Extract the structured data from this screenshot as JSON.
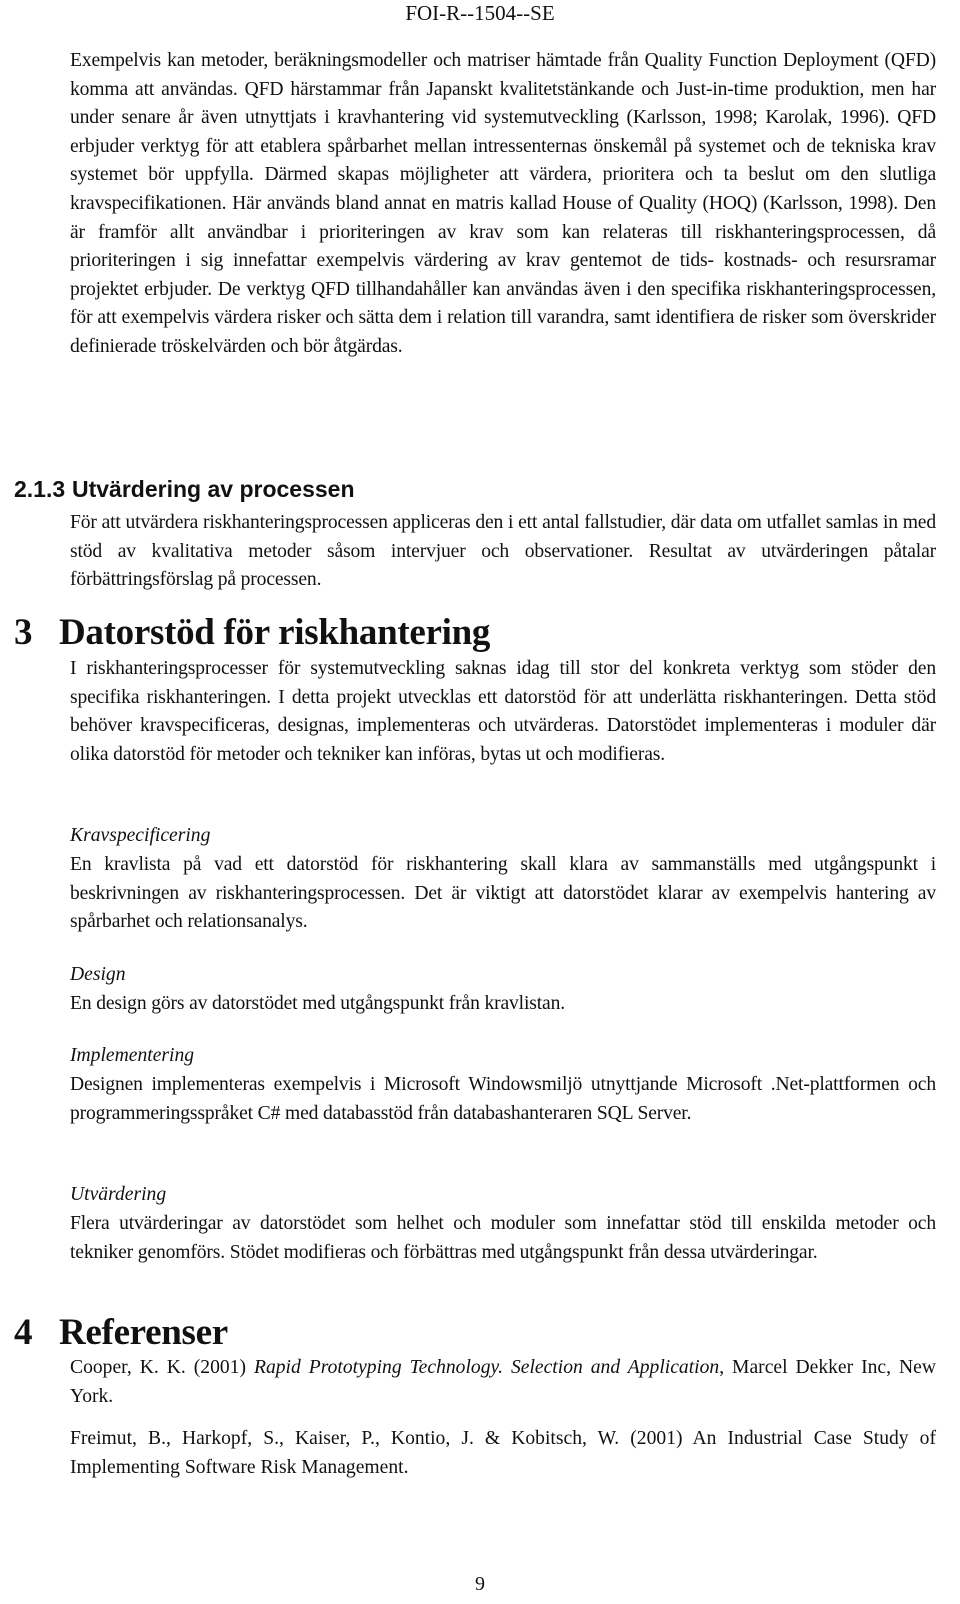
{
  "header": {
    "report_id": "FOI-R--1504--SE"
  },
  "intro_paragraph": "Exempelvis kan metoder, beräkningsmodeller och matriser hämtade från Quality Function Deployment (QFD) komma att användas. QFD härstammar från Japanskt kvalitetstänkande och Just-in-time produktion, men har under senare år även utnyttjats i kravhantering vid systemutveckling (Karlsson, 1998; Karolak, 1996). QFD erbjuder verktyg för att etablera spårbarhet mellan intressenternas önskemål på systemet och de tekniska krav systemet bör uppfylla. Därmed skapas möjligheter att värdera, prioritera och ta beslut om den slutliga kravspecifikationen. Här används bland annat en matris kallad House of Quality (HOQ) (Karlsson, 1998). Den är framför allt användbar i prioriteringen av krav som kan relateras till riskhanteringsprocessen, då prioriteringen i sig innefattar exempelvis värdering av krav gentemot de tids- kostnads- och resursramar projektet erbjuder. De verktyg QFD tillhandahåller kan användas även i den specifika riskhanteringsprocessen, för att exempelvis värdera risker och sätta dem i relation till varandra, samt identifiera de risker som överskrider definierade tröskelvärden och bör åtgärdas.",
  "section_2_1_3": {
    "number": "2.1.3",
    "title": "Utvärdering av processen",
    "paragraph": "För att utvärdera riskhanteringsprocessen appliceras den i ett antal fallstudier, där data om utfallet samlas in med stöd av kvalitativa metoder såsom intervjuer och observationer. Resultat av utvärderingen påtalar förbättringsförslag på processen."
  },
  "section_3": {
    "number": "3",
    "title": "Datorstöd för riskhantering",
    "paragraph": "I riskhanteringsprocesser för systemutveckling saknas idag till stor del konkreta verktyg som stöder den specifika riskhanteringen. I detta projekt utvecklas ett datorstöd för att underlätta riskhanteringen. Detta stöd behöver kravspecificeras, designas, implementeras och utvärderas. Datorstödet implementeras i moduler där olika datorstöd för metoder och tekniker kan införas, bytas ut och modifieras.",
    "subsections": [
      {
        "title": "Kravspecificering",
        "text": "En kravlista på vad ett datorstöd för riskhantering skall klara av sammanställs med utgångspunkt i beskrivningen av riskhanteringsprocessen. Det är viktigt att datorstödet klarar av exempelvis hantering av spårbarhet och relationsanalys."
      },
      {
        "title": "Design",
        "text": "En design görs av datorstödet med utgångspunkt från kravlistan."
      },
      {
        "title": "Implementering",
        "text": "Designen implementeras exempelvis i Microsoft Windowsmiljö utnyttjande Microsoft .Net-plattformen och programmeringsspråket C# med databasstöd från databashanteraren SQL Server."
      },
      {
        "title": "Utvärdering",
        "text": "Flera utvärderingar av datorstödet som helhet och moduler som innefattar stöd till enskilda metoder och tekniker genomförs. Stödet modifieras och förbättras med utgångspunkt från dessa utvärderingar."
      }
    ]
  },
  "section_4": {
    "number": "4",
    "title": "Referenser",
    "references": [
      {
        "prefix": "Cooper, K. K. (2001) ",
        "italic": "Rapid Prototyping Technology. Selection and Application",
        "suffix": ", Marcel Dekker Inc, New York."
      },
      {
        "prefix": "Freimut, B., Harkopf, S., Kaiser, P., Kontio, J. & Kobitsch, W. (2001) An Industrial Case Study of Implementing Software Risk Management.",
        "italic": "",
        "suffix": ""
      }
    ]
  },
  "footer": {
    "page_number": "9"
  }
}
